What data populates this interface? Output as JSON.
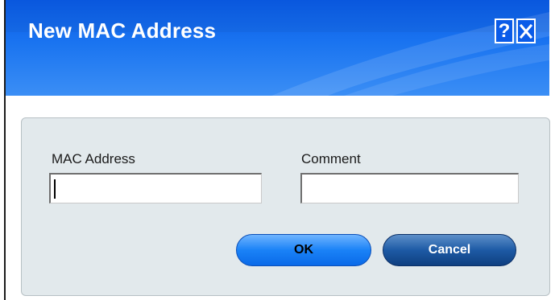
{
  "dialog": {
    "title": "New MAC Address",
    "help_glyph": "?",
    "close_icon": "close-icon"
  },
  "form": {
    "mac_label": "MAC Address",
    "mac_value": "",
    "comment_label": "Comment",
    "comment_value": ""
  },
  "buttons": {
    "ok_label": "OK",
    "cancel_label": "Cancel"
  },
  "colors": {
    "title_bar": "#0a5be8",
    "content_bg": "#e2e9ec",
    "ok_button": "#1a82f7",
    "cancel_button": "#1d5aa5"
  }
}
